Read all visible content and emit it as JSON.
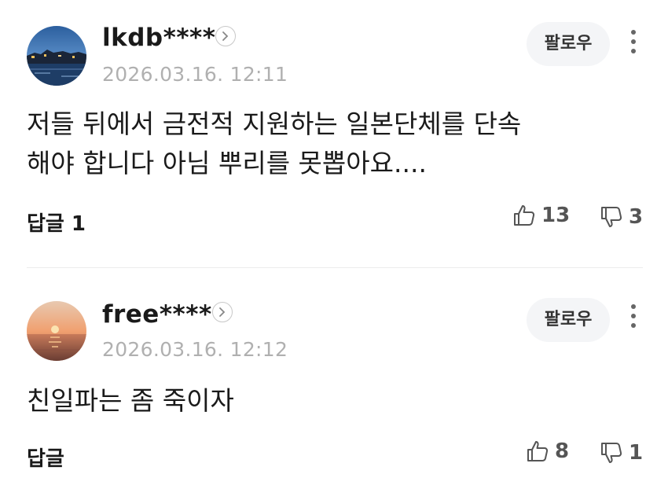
{
  "comments": [
    {
      "username": "lkdb****",
      "date": "2026.03.16. 12:11",
      "follow_label": "팔로우",
      "text_lines": [
        "저들 뒤에서 금전적 지원하는 일본단체를 단속",
        "해야 합니다 아님 뿌리를 못뽑아요...."
      ],
      "reply_label": "답글 1",
      "likes": "13",
      "dislikes": "3",
      "avatar_icon": "night-cityscape-avatar"
    },
    {
      "username": "free****",
      "date": "2026.03.16. 12:12",
      "follow_label": "팔로우",
      "text_lines": [
        "친일파는 좀 죽이자"
      ],
      "reply_label": "답글",
      "likes": "8",
      "dislikes": "1",
      "avatar_icon": "sunset-sea-avatar"
    }
  ],
  "icons": {
    "like": "thumbs-up-icon",
    "dislike": "thumbs-down-icon",
    "more": "more-vertical-icon",
    "profile": "chevron-right-icon"
  },
  "colors": {
    "date": "#b0b0b0",
    "follow_bg": "#f4f5f7",
    "divider": "#ececec"
  }
}
